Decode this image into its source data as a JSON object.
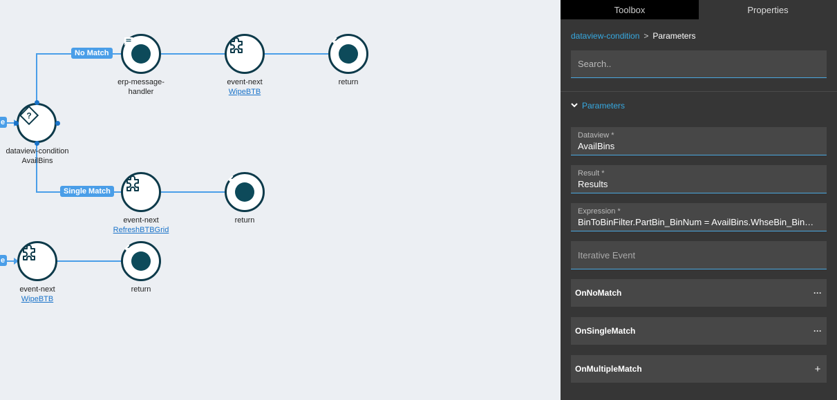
{
  "canvas": {
    "badges": {
      "no_match": "No Match",
      "single_match": "Single Match",
      "left_top": "e",
      "left_bottom": "e"
    },
    "nodes": {
      "condition": {
        "title": "dataview-condition",
        "sub": "AvailBins",
        "icon": "question-diamond-icon"
      },
      "erp": {
        "title": "erp-message-handler",
        "icon": "message-icon"
      },
      "event_top": {
        "title": "event-next",
        "link": "WipeBTB",
        "icon": "puzzle-icon"
      },
      "return_top": {
        "title": "return",
        "icon": "arrow-left-icon"
      },
      "event_mid": {
        "title": "event-next",
        "link": "RefreshBTBGrid",
        "icon": "puzzle-icon"
      },
      "return_mid": {
        "title": "return",
        "icon": "arrow-left-icon"
      },
      "event_bot": {
        "title": "event-next",
        "link": "WipeBTB",
        "icon": "puzzle-icon"
      },
      "return_bot": {
        "title": "return",
        "icon": "arrow-left-icon"
      }
    }
  },
  "panel": {
    "tabs": {
      "toolbox": "Toolbox",
      "properties": "Properties"
    },
    "breadcrumb": {
      "link": "dataview-condition",
      "sep": ">",
      "current": "Parameters"
    },
    "search": {
      "placeholder": "Search.."
    },
    "section": {
      "title": "Parameters"
    },
    "fields": {
      "dataview": {
        "label": "Dataview *",
        "value": "AvailBins"
      },
      "result": {
        "label": "Result *",
        "value": "Results"
      },
      "expression": {
        "label": "Expression *",
        "value": "BinToBinFilter.PartBin_BinNum = AvailBins.WhseBin_BinNum"
      },
      "iterative": {
        "placeholder": "Iterative Event"
      }
    },
    "events": {
      "no_match": {
        "label": "OnNoMatch",
        "action": "···"
      },
      "single_match": {
        "label": "OnSingleMatch",
        "action": "···"
      },
      "multiple_match": {
        "label": "OnMultipleMatch",
        "action": "+"
      }
    }
  },
  "colors": {
    "accent": "#4a9ee8",
    "node_border": "#0d3a4a",
    "panel_bg": "#363636",
    "link": "#36a9e1"
  }
}
